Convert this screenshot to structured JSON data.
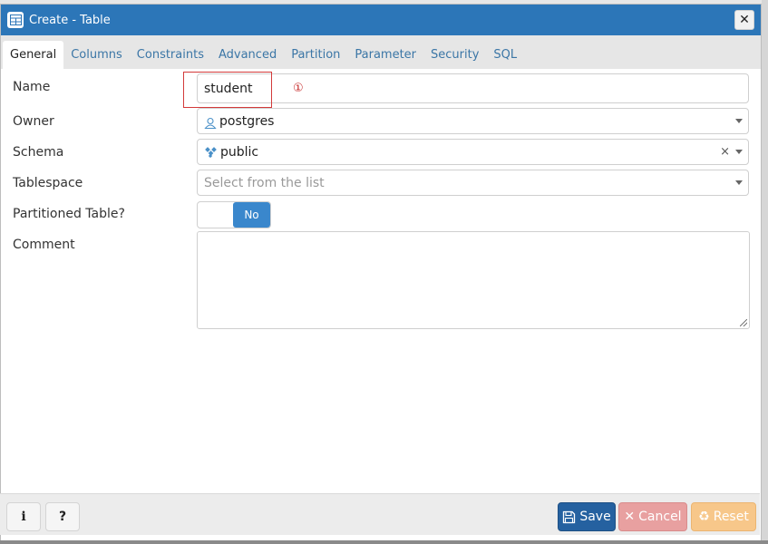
{
  "window": {
    "title": "Create - Table",
    "close_icon": "close-icon",
    "title_icon": "table-icon"
  },
  "tabs": [
    {
      "label": "General",
      "active": true
    },
    {
      "label": "Columns",
      "active": false
    },
    {
      "label": "Constraints",
      "active": false
    },
    {
      "label": "Advanced",
      "active": false
    },
    {
      "label": "Partition",
      "active": false
    },
    {
      "label": "Parameter",
      "active": false
    },
    {
      "label": "Security",
      "active": false
    },
    {
      "label": "SQL",
      "active": false
    }
  ],
  "form": {
    "name": {
      "label": "Name",
      "value": "student"
    },
    "owner": {
      "label": "Owner",
      "value": "postgres",
      "icon": "user-icon"
    },
    "schema": {
      "label": "Schema",
      "value": "public",
      "icon": "schema-icon",
      "clear": "×"
    },
    "tablespace": {
      "label": "Tablespace",
      "placeholder": "Select from the list"
    },
    "partitioned": {
      "label": "Partitioned Table?",
      "value": "No"
    },
    "comment": {
      "label": "Comment",
      "value": ""
    }
  },
  "annotation": {
    "marker": "①",
    "color": "#d33a3a"
  },
  "footer": {
    "info_label": "i",
    "help_label": "?",
    "save_label": "Save",
    "cancel_label": "Cancel",
    "reset_label": "Reset"
  },
  "colors": {
    "titlebar": "#2c76b8",
    "save": "#2561a0",
    "cancel": "#e8a0a0",
    "reset": "#f7c78a",
    "toggle_on": "#3a87cc"
  }
}
